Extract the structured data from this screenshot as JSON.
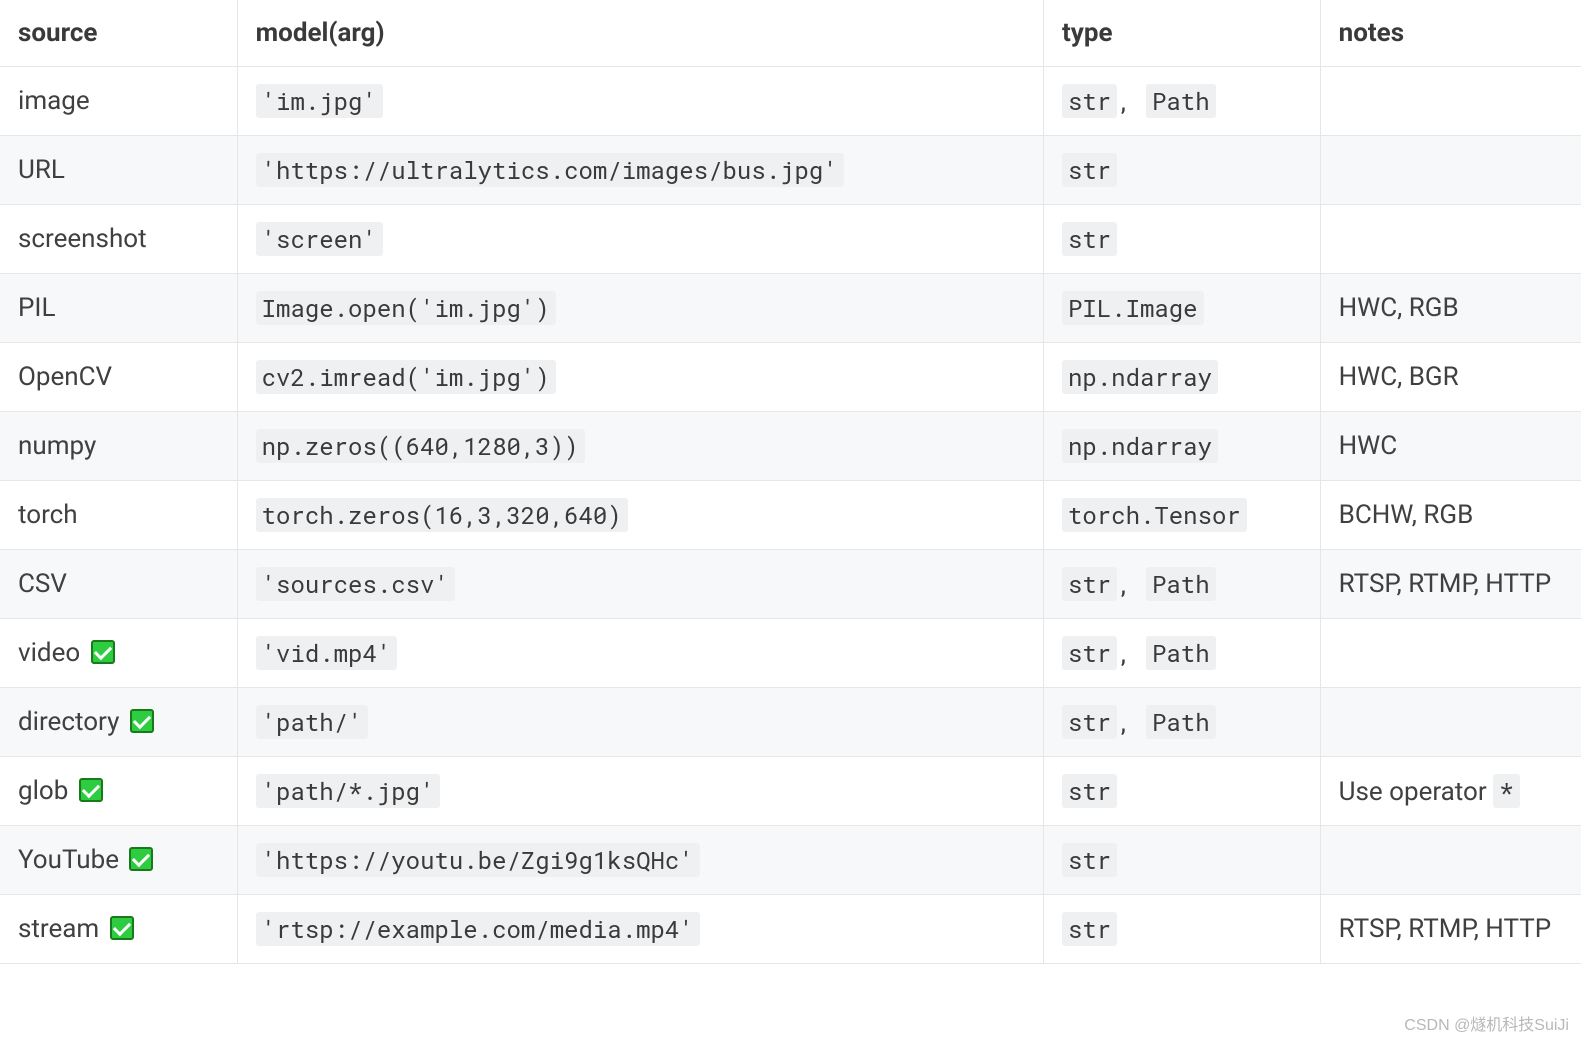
{
  "headers": {
    "source": "source",
    "model": "model(arg)",
    "type": "type",
    "notes": "notes"
  },
  "rows": [
    {
      "source": "image",
      "check": false,
      "model": "'im.jpg'",
      "type": [
        "str",
        "Path"
      ],
      "notes_plain": ""
    },
    {
      "source": "URL",
      "check": false,
      "model": "'https://ultralytics.com/images/bus.jpg'",
      "type": [
        "str"
      ],
      "notes_plain": ""
    },
    {
      "source": "screenshot",
      "check": false,
      "model": "'screen'",
      "type": [
        "str"
      ],
      "notes_plain": ""
    },
    {
      "source": "PIL",
      "check": false,
      "model": "Image.open('im.jpg')",
      "type": [
        "PIL.Image"
      ],
      "notes_plain": "HWC, RGB"
    },
    {
      "source": "OpenCV",
      "check": false,
      "model": "cv2.imread('im.jpg')",
      "type": [
        "np.ndarray"
      ],
      "notes_plain": "HWC, BGR"
    },
    {
      "source": "numpy",
      "check": false,
      "model": "np.zeros((640,1280,3))",
      "type": [
        "np.ndarray"
      ],
      "notes_plain": "HWC"
    },
    {
      "source": "torch",
      "check": false,
      "model": "torch.zeros(16,3,320,640)",
      "type": [
        "torch.Tensor"
      ],
      "notes_plain": "BCHW, RGB"
    },
    {
      "source": "CSV",
      "check": false,
      "model": "'sources.csv'",
      "type": [
        "str",
        "Path"
      ],
      "notes_plain": "RTSP, RTMP, HTTP"
    },
    {
      "source": "video",
      "check": true,
      "model": "'vid.mp4'",
      "type": [
        "str",
        "Path"
      ],
      "notes_plain": ""
    },
    {
      "source": "directory",
      "check": true,
      "model": "'path/'",
      "type": [
        "str",
        "Path"
      ],
      "notes_plain": ""
    },
    {
      "source": "glob",
      "check": true,
      "model": "'path/*.jpg'",
      "type": [
        "str"
      ],
      "notes_pre": "Use operator ",
      "notes_code": "*"
    },
    {
      "source": "YouTube",
      "check": true,
      "model": "'https://youtu.be/Zgi9g1ksQHc'",
      "type": [
        "str"
      ],
      "notes_plain": ""
    },
    {
      "source": "stream",
      "check": true,
      "model": "'rtsp://example.com/media.mp4'",
      "type": [
        "str"
      ],
      "notes_plain": "RTSP, RTMP, HTTP"
    }
  ],
  "watermark": "CSDN @燧机科技SuiJi"
}
